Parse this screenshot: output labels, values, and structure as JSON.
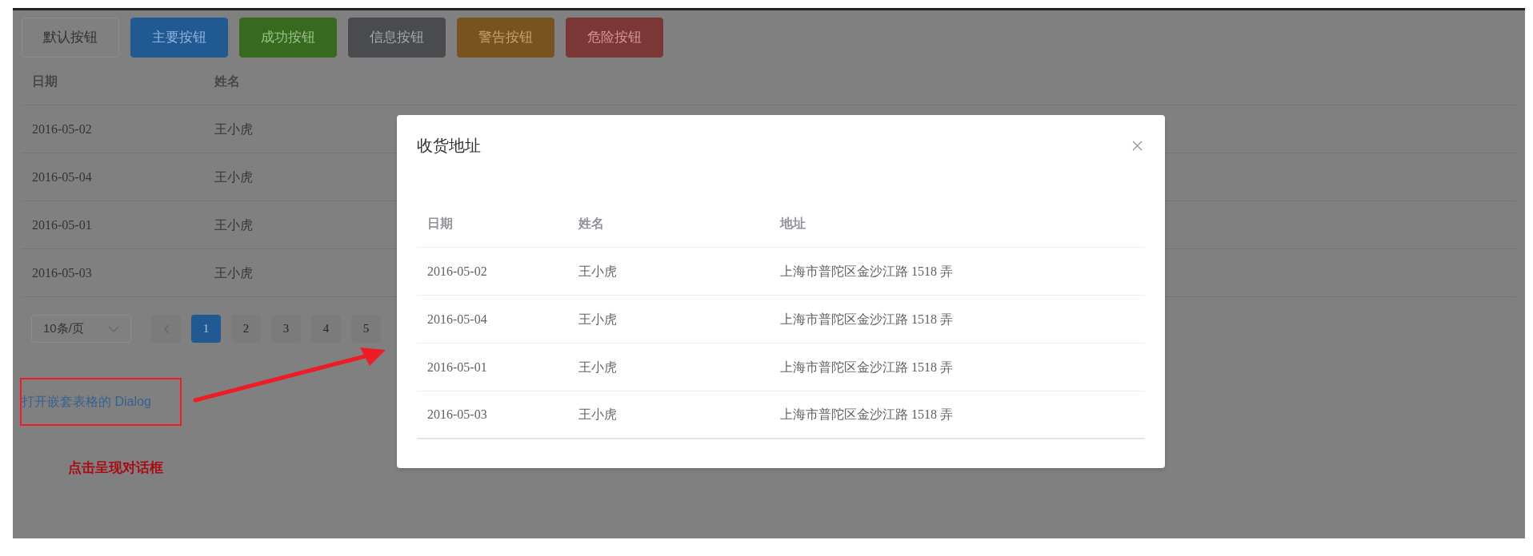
{
  "buttons": [
    {
      "label": "默认按钮",
      "kind": "default"
    },
    {
      "label": "主要按钮",
      "kind": "primary"
    },
    {
      "label": "成功按钮",
      "kind": "success"
    },
    {
      "label": "信息按钮",
      "kind": "info"
    },
    {
      "label": "警告按钮",
      "kind": "warning"
    },
    {
      "label": "危险按钮",
      "kind": "danger"
    }
  ],
  "table": {
    "columns": [
      "日期",
      "姓名"
    ],
    "rows": [
      {
        "date": "2016-05-02",
        "name": "王小虎"
      },
      {
        "date": "2016-05-04",
        "name": "王小虎"
      },
      {
        "date": "2016-05-01",
        "name": "王小虎"
      },
      {
        "date": "2016-05-03",
        "name": "王小虎"
      }
    ]
  },
  "pagination": {
    "page_size": "10条/页",
    "pages": [
      {
        "label": "1",
        "selected": true
      },
      {
        "label": "2",
        "selected": false
      },
      {
        "label": "3",
        "selected": false
      },
      {
        "label": "4",
        "selected": false
      },
      {
        "label": "5",
        "selected": false
      }
    ]
  },
  "link": "打开嵌套表格的 Dialog",
  "annotation": "点击呈现对话框",
  "dialog": {
    "title": "收货地址",
    "table": {
      "columns": [
        "日期",
        "姓名",
        "地址"
      ],
      "rows": [
        {
          "date": "2016-05-02",
          "name": "王小虎",
          "address": "上海市普陀区金沙江路 1518 弄"
        },
        {
          "date": "2016-05-04",
          "name": "王小虎",
          "address": "上海市普陀区金沙江路 1518 弄"
        },
        {
          "date": "2016-05-01",
          "name": "王小虎",
          "address": "上海市普陀区金沙江路 1518 弄"
        },
        {
          "date": "2016-05-03",
          "name": "王小虎",
          "address": "上海市普陀区金沙江路 1518 弄"
        }
      ]
    }
  }
}
